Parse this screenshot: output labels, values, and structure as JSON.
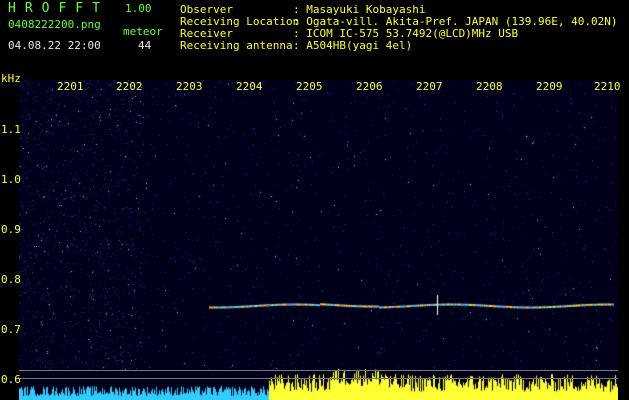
{
  "app": {
    "title": "HROFFT",
    "version": "1.00"
  },
  "file": {
    "name": "0408222200.png",
    "datetime": "04.08.22 22:00"
  },
  "meteor": {
    "label": "meteor",
    "count": "44"
  },
  "info": {
    "labels": [
      "Observer",
      "Receiving Location",
      "Receiver",
      "Receiving antenna"
    ],
    "values": [
      ": Masayuki Kobayashi",
      ": Ogata-vill. Akita-Pref. JAPAN (139.96E, 40.02N)",
      ": ICOM IC-575 53.7492(@LCD)MHz USB",
      ": A504HB(yagi 4el)"
    ]
  },
  "axis": {
    "y_unit": "kHz",
    "y_ticks": [
      "1.1",
      "1.0",
      "0.9",
      "0.8",
      "0.7",
      "0.6"
    ],
    "x_ticks": [
      "2201",
      "2202",
      "2203",
      "2204",
      "2205",
      "2206",
      "2207",
      "2208",
      "2209",
      "2210"
    ]
  },
  "colors": {
    "header_green": "#66ff33",
    "header_yellow": "#ffff33",
    "signal_cyan": "#00ffff"
  }
}
